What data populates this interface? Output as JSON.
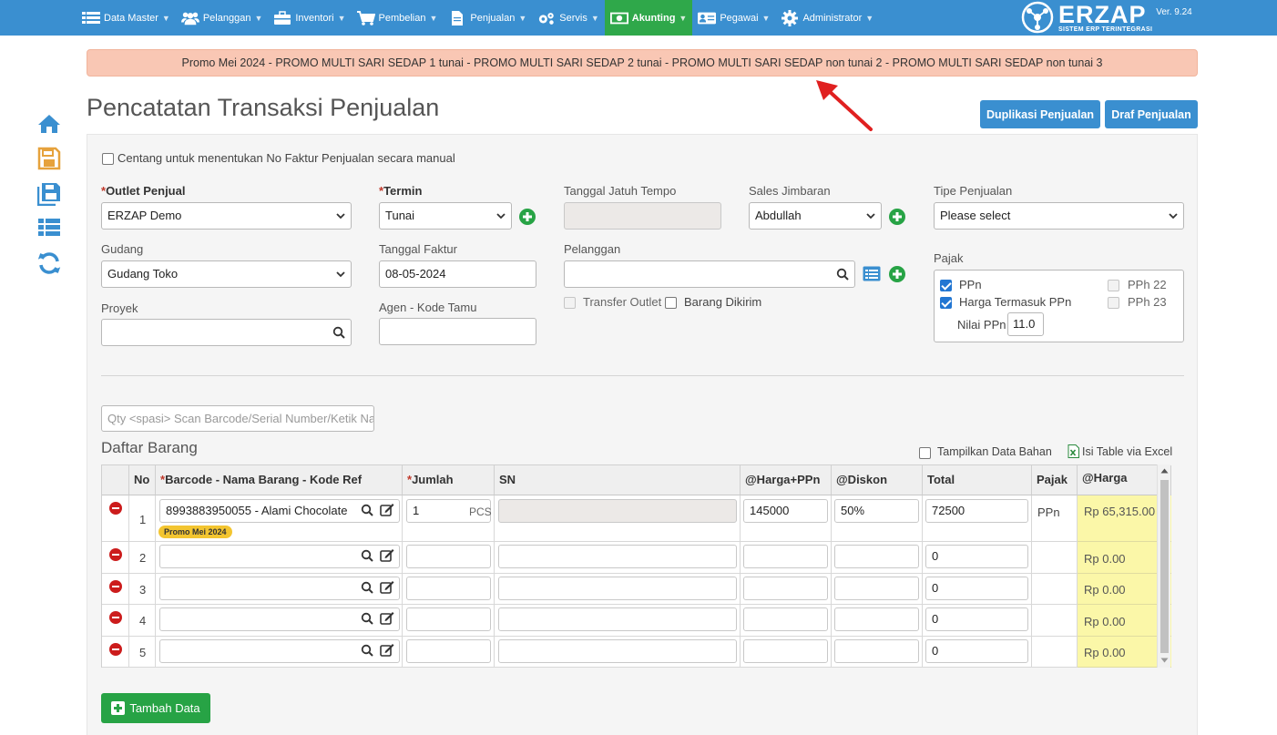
{
  "nav": {
    "items": [
      {
        "label": "Data Master",
        "icon": "list-icon"
      },
      {
        "label": "Pelanggan",
        "icon": "users-icon"
      },
      {
        "label": "Inventori",
        "icon": "briefcase-icon"
      },
      {
        "label": "Pembelian",
        "icon": "cart-icon"
      },
      {
        "label": "Penjualan",
        "icon": "document-icon"
      },
      {
        "label": "Servis",
        "icon": "cogs-icon"
      },
      {
        "label": "Akunting",
        "icon": "money-icon"
      },
      {
        "label": "Pegawai",
        "icon": "id-card-icon"
      },
      {
        "label": "Administrator",
        "icon": "gear-icon"
      }
    ],
    "active": "Akunting",
    "brand_name": "ERZAP",
    "brand_sub": "SISTEM ERP TERINTEGRASI",
    "brand_version": "Ver. 9.24"
  },
  "promo_text": "Promo Mei 2024 - PROMO MULTI SARI SEDAP 1 tunai - PROMO MULTI SARI SEDAP 2 tunai - PROMO MULTI SARI SEDAP non tunai 2 - PROMO MULTI SARI SEDAP non tunai 3",
  "page": {
    "title": "Pencatatan Transaksi Penjualan",
    "dup_button": "Duplikasi Penjualan",
    "draft_button": "Draf Penjualan"
  },
  "form": {
    "manual_invoice_label": "Centang untuk menentukan No Faktur Penjualan secara manual",
    "outlet_label": "Outlet Penjual",
    "outlet_value": "ERZAP Demo",
    "gudang_label": "Gudang",
    "gudang_value": "Gudang Toko",
    "proyek_label": "Proyek",
    "proyek_value": "",
    "termin_label": "Termin",
    "termin_value": "Tunai",
    "tanggal_faktur_label": "Tanggal Faktur",
    "tanggal_faktur_value": "08-05-2024",
    "agen_label": "Agen - Kode Tamu",
    "agen_value": "",
    "jatuh_tempo_label": "Tanggal Jatuh Tempo",
    "jatuh_tempo_value": "",
    "pelanggan_label": "Pelanggan",
    "pelanggan_value": "",
    "transfer_outlet_label": "Transfer Outlet",
    "barang_dikirim_label": "Barang Dikirim",
    "sales_label": "Sales Jimbaran",
    "sales_value": "Abdullah",
    "tipe_label": "Tipe Penjualan",
    "tipe_value": "Please select",
    "pajak_label": "Pajak",
    "ppn_label": "PPn",
    "harga_termasuk_label": "Harga Termasuk PPn",
    "nilai_ppn_label": "Nilai PPn",
    "nilai_ppn_value": "11.0",
    "pph22_label": "PPh 22",
    "pph23_label": "PPh 23"
  },
  "items": {
    "scan_placeholder": "Qty <spasi> Scan Barcode/Serial Number/Ketik Nama",
    "section_title": "Daftar Barang",
    "show_bahan_label": "Tampilkan Data Bahan",
    "excel_label": "Isi Table via Excel",
    "headers": {
      "no": "No",
      "barcode": "Barcode - Nama Barang - Kode Ref",
      "jumlah": "Jumlah",
      "sn": "SN",
      "harga_ppn": "@Harga+PPn",
      "diskon": "@Diskon",
      "total": "Total",
      "pajak": "Pajak",
      "harga": "@Harga"
    },
    "rows": [
      {
        "no": "1",
        "barcode": "8993883950055 - Alami Chocolate",
        "badge": "Promo Mei 2024",
        "jumlah": "1",
        "unit": "PCS",
        "harga_ppn": "145000",
        "diskon": "50%",
        "total": "72500",
        "pajak": "PPn",
        "harga": "Rp 65,315.00"
      },
      {
        "no": "2",
        "barcode": "",
        "jumlah": "",
        "unit": "",
        "harga_ppn": "",
        "diskon": "",
        "total": "0",
        "pajak": "",
        "harga": "Rp 0.00"
      },
      {
        "no": "3",
        "barcode": "",
        "jumlah": "",
        "unit": "",
        "harga_ppn": "",
        "diskon": "",
        "total": "0",
        "pajak": "",
        "harga": "Rp 0.00"
      },
      {
        "no": "4",
        "barcode": "",
        "jumlah": "",
        "unit": "",
        "harga_ppn": "",
        "diskon": "",
        "total": "0",
        "pajak": "",
        "harga": "Rp 0.00"
      },
      {
        "no": "5",
        "barcode": "",
        "jumlah": "",
        "unit": "",
        "harga_ppn": "",
        "diskon": "",
        "total": "0",
        "pajak": "",
        "harga": "Rp 0.00"
      }
    ],
    "add_button": "Tambah Data"
  },
  "colors": {
    "navbar": "#3a8fd0",
    "nav_active": "#2fa84a",
    "promo_bg": "#f9c7b4",
    "primary_button": "#3a8fd0",
    "success_button": "#27a345",
    "highlight_cell": "#fbf7a8",
    "annotation_arrow": "#e02020"
  }
}
